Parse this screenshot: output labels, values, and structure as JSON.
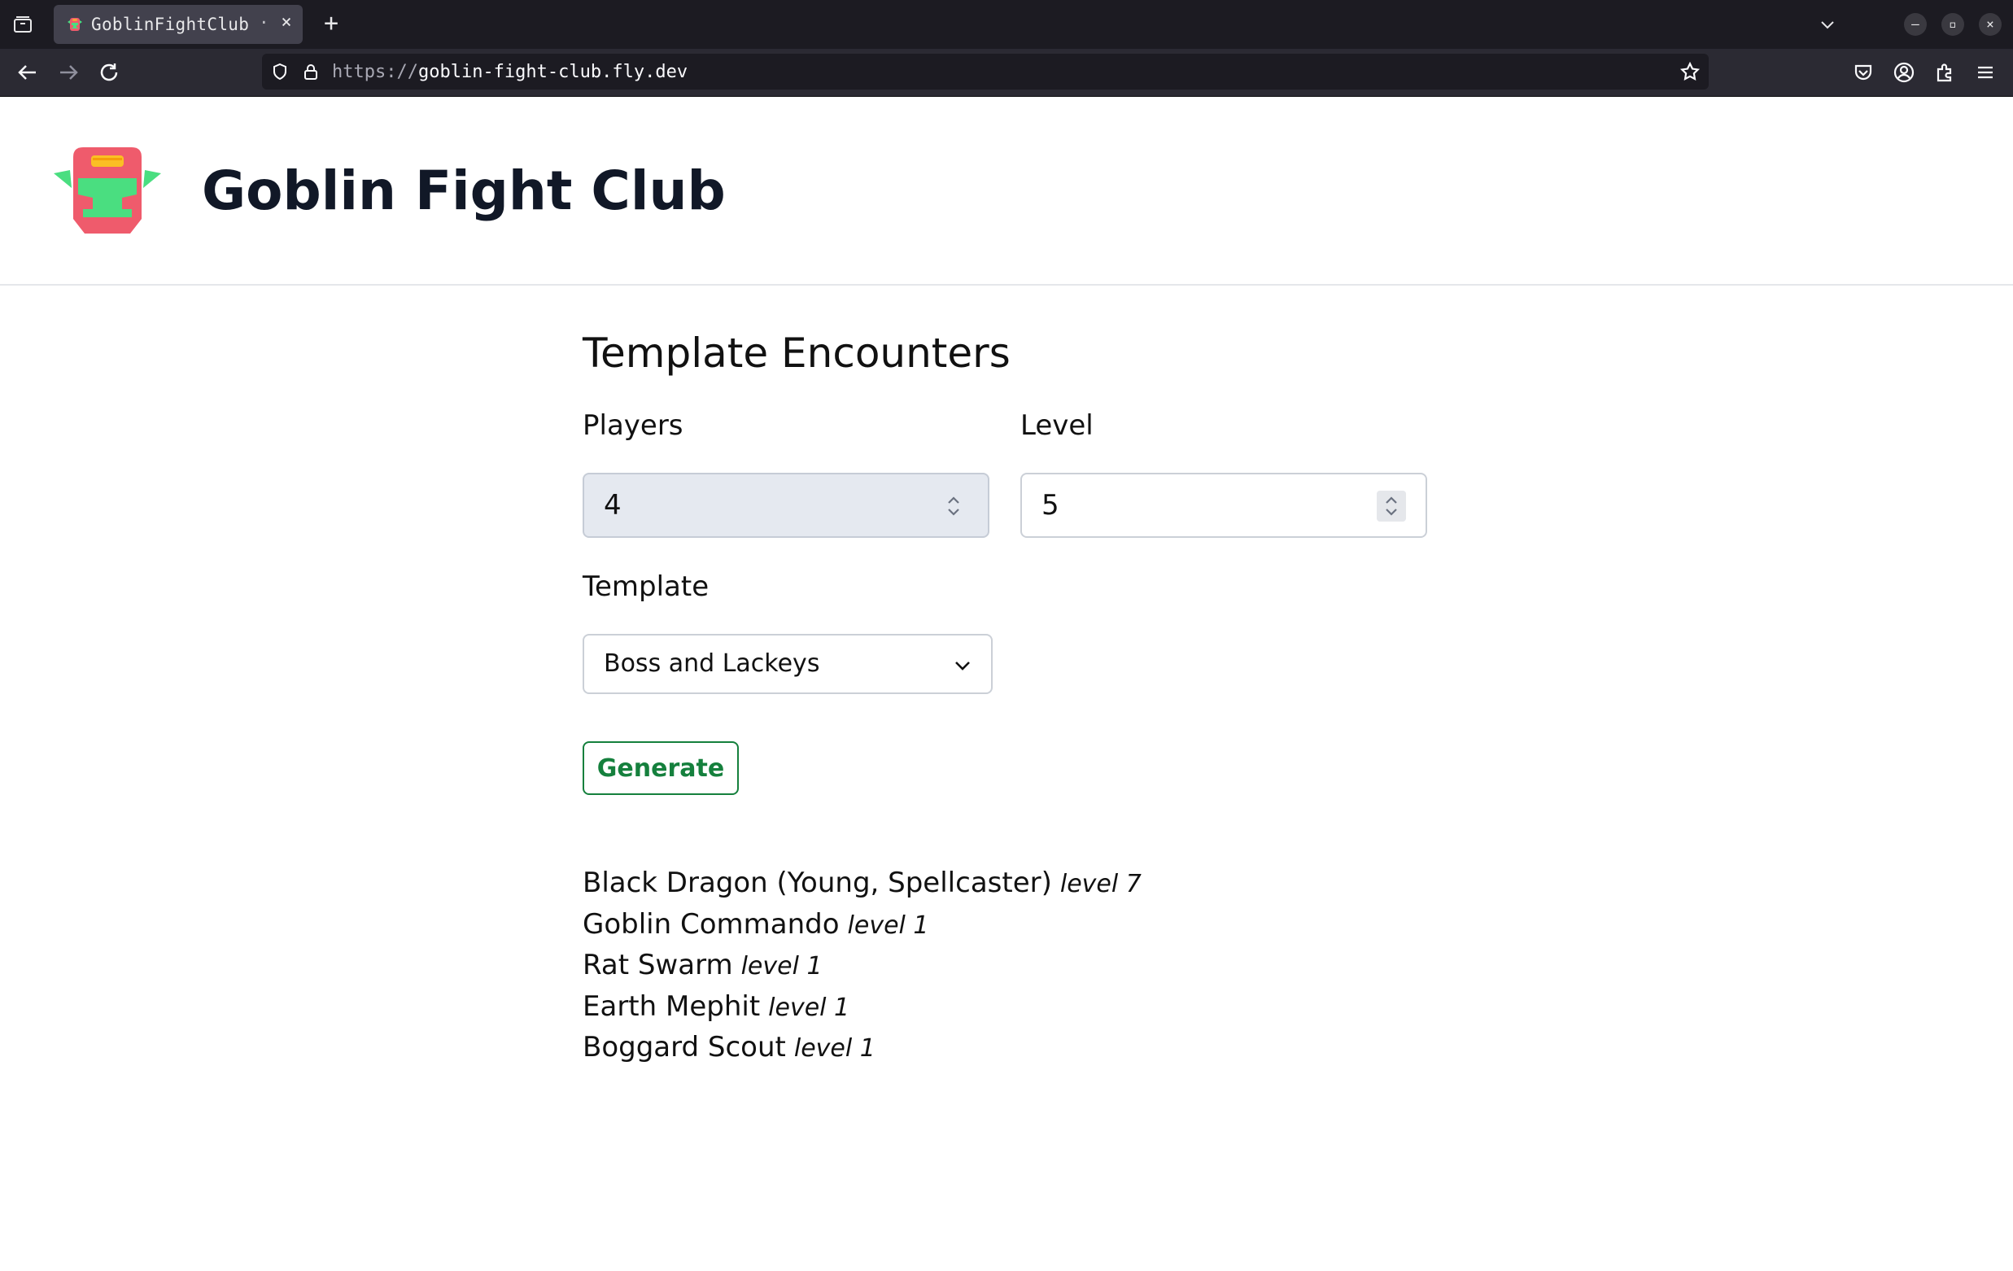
{
  "browser": {
    "tab_title": "GoblinFightClub",
    "tab_separator": "·",
    "url_scheme": "https://",
    "url_host": "goblin-fight-club.fly.dev"
  },
  "header": {
    "title": "Goblin Fight Club",
    "logo_colors": {
      "shield": "#ef5b6c",
      "face": "#4ade80",
      "band": "#fbbf24"
    }
  },
  "form": {
    "heading": "Template Encounters",
    "players_label": "Players",
    "players_value": "4",
    "level_label": "Level",
    "level_value": "5",
    "template_label": "Template",
    "template_value": "Boss and Lackeys",
    "generate_label": "Generate"
  },
  "results": [
    {
      "name": "Black Dragon (Young, Spellcaster)",
      "level": "level 7"
    },
    {
      "name": "Goblin Commando",
      "level": "level 1"
    },
    {
      "name": "Rat Swarm",
      "level": "level 1"
    },
    {
      "name": "Earth Mephit",
      "level": "level 1"
    },
    {
      "name": "Boggard Scout",
      "level": "level 1"
    }
  ],
  "colors": {
    "accent": "#15803d",
    "text": "#111827"
  }
}
